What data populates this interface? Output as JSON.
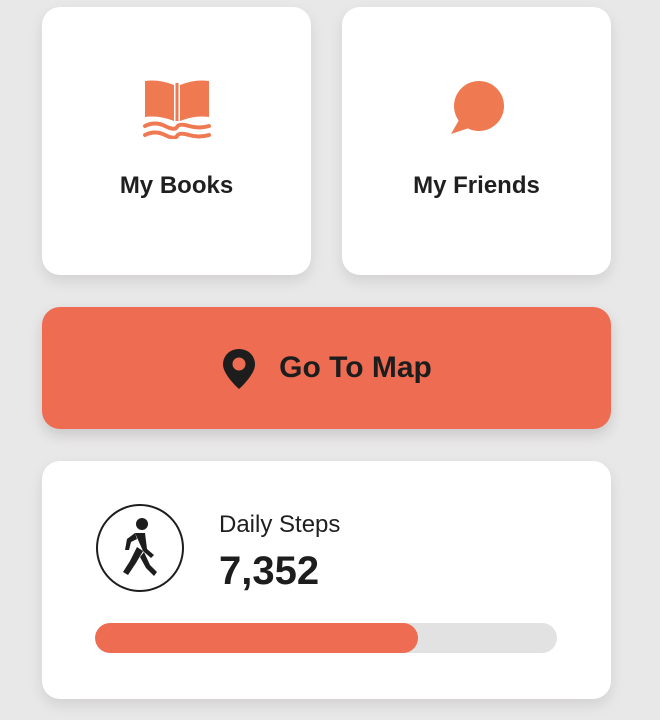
{
  "tiles": {
    "books": {
      "label": "My Books",
      "icon": "book-icon"
    },
    "friends": {
      "label": "My Friends",
      "icon": "chat-bubble-icon"
    }
  },
  "map_button": {
    "label": "Go To Map",
    "icon": "map-pin-icon"
  },
  "steps": {
    "title": "Daily Steps",
    "value": "7,352",
    "icon": "walking-person-icon",
    "progress_fraction": 0.7
  },
  "colors": {
    "accent": "#ee6c52",
    "icon_orange": "#ef7a52",
    "background": "#e9e8e8",
    "card": "#ffffff",
    "text": "#1d1d1d",
    "track": "#e2e2e2"
  }
}
